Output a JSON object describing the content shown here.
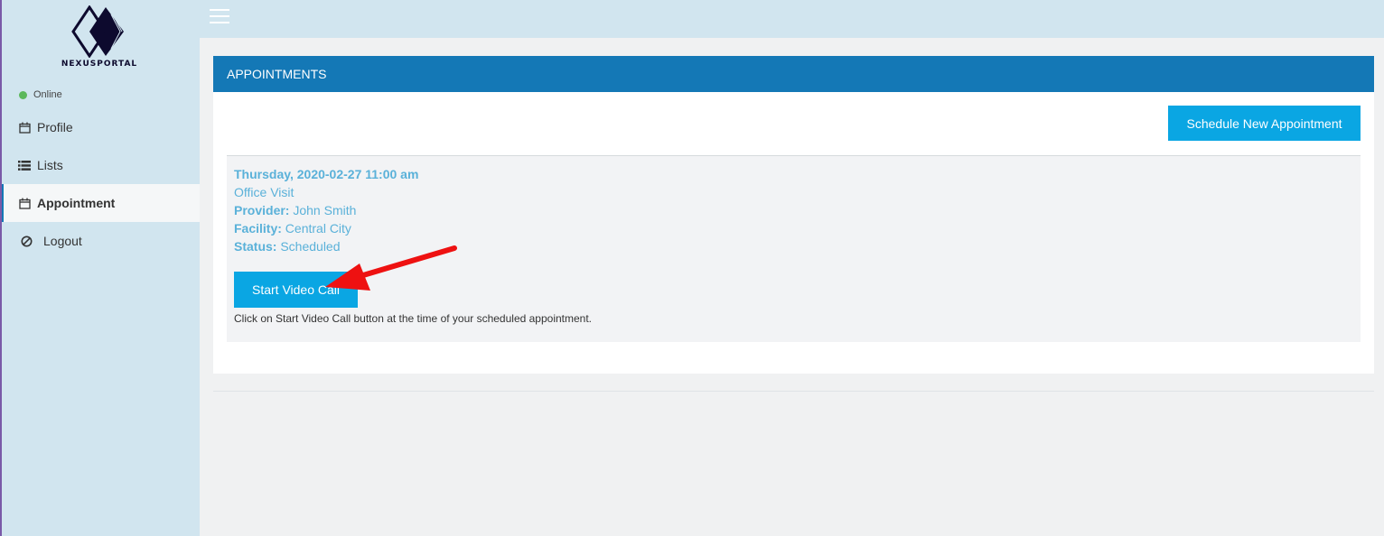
{
  "brand": {
    "name": "NEXUSPORTAL"
  },
  "user_status": {
    "label": "Online",
    "color": "#5cb85c"
  },
  "sidebar": {
    "items": [
      {
        "label": "Profile",
        "icon": "calendar-icon"
      },
      {
        "label": "Lists",
        "icon": "list-icon"
      },
      {
        "label": "Appointment",
        "icon": "calendar-icon",
        "active": true
      },
      {
        "label": "Logout",
        "icon": "ban-icon"
      }
    ]
  },
  "panel": {
    "title": "APPOINTMENTS",
    "schedule_button": "Schedule New Appointment"
  },
  "appointment": {
    "datetime": "Thursday, 2020-02-27 11:00 am",
    "type": "Office Visit",
    "provider_label": "Provider:",
    "provider": "John Smith",
    "facility_label": "Facility:",
    "facility": "Central City",
    "status_label": "Status:",
    "status": "Scheduled",
    "video_button": "Start Video Call",
    "help_text": "Click on Start Video Call button at the time of your scheduled appointment."
  },
  "colors": {
    "accent": "#1478b6",
    "button": "#0aa6e3",
    "sidebar_bg": "#d1e5ef",
    "appointment_text": "#5ab1d9",
    "annotation_arrow": "#ee1111"
  }
}
